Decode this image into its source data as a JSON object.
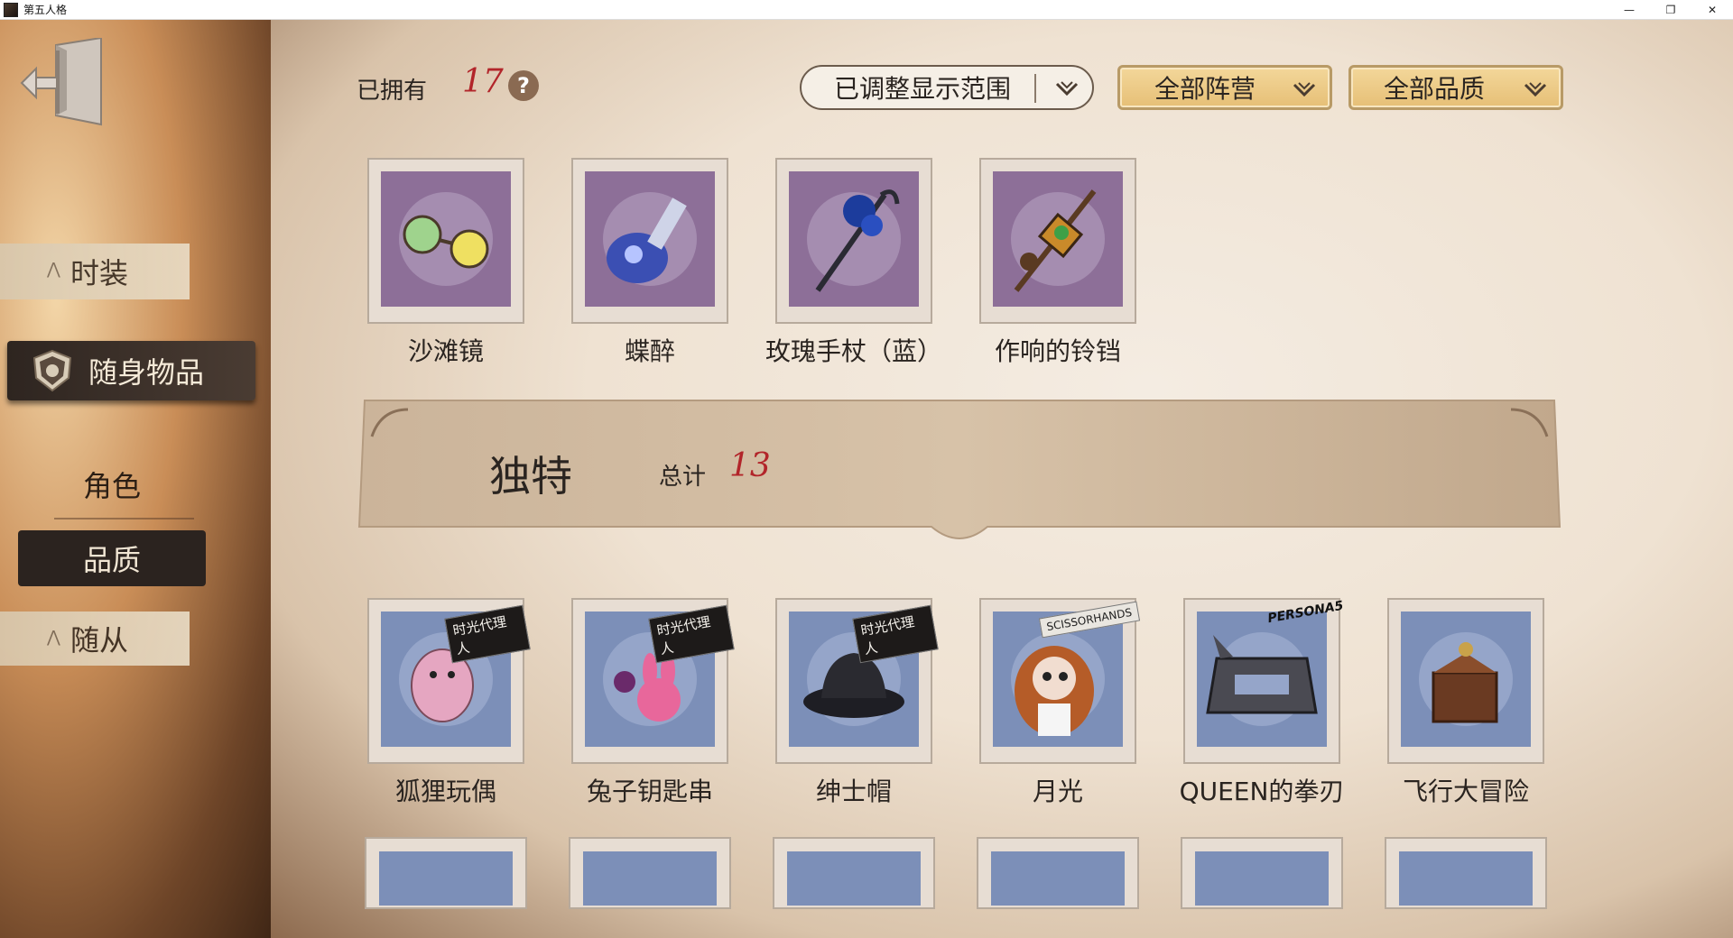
{
  "window": {
    "title": "第五人格",
    "controls": [
      "—",
      "❐",
      "✕"
    ]
  },
  "sidebar": {
    "back_icon": "exit-door-icon",
    "items": [
      {
        "label": "时装"
      },
      {
        "label": "随身物品"
      },
      {
        "label": "角色"
      },
      {
        "label": "品质"
      },
      {
        "label": "随从"
      }
    ]
  },
  "header": {
    "owned_label": "已拥有",
    "owned_count": "17",
    "help_glyph": "?",
    "filters": {
      "range": "已调整显示范围",
      "camp": "全部阵营",
      "quality": "全部品质"
    }
  },
  "top_items": [
    {
      "name": "沙滩镜",
      "icon": "goggles-icon"
    },
    {
      "name": "蝶醉",
      "icon": "potion-bottle-icon"
    },
    {
      "name": "玫瑰手杖（蓝）",
      "icon": "rose-cane-icon"
    },
    {
      "name": "作响的铃铛",
      "icon": "bell-staff-icon"
    }
  ],
  "section": {
    "title": "独特",
    "total_label": "总计",
    "total": "13"
  },
  "unique_items": [
    {
      "name": "狐狸玩偶",
      "icon": "fox-doll-icon",
      "tag": "时光代理人"
    },
    {
      "name": "兔子钥匙串",
      "icon": "rabbit-keychain-icon",
      "tag": "时光代理人"
    },
    {
      "name": "绅士帽",
      "icon": "gentleman-hat-icon",
      "tag": "时光代理人"
    },
    {
      "name": "月光",
      "icon": "moonlight-doll-icon",
      "tag": "SCISSORHANDS"
    },
    {
      "name": "QUEEN的拳刃",
      "icon": "knuckle-blade-icon",
      "tag": "PERSONA5"
    },
    {
      "name": "飞行大冒险",
      "icon": "flying-machine-icon",
      "tag": ""
    }
  ],
  "colors": {
    "accent_red": "#b2252a",
    "stamp_purple": "#8d6f98",
    "stamp_blue": "#7c8fb8"
  }
}
